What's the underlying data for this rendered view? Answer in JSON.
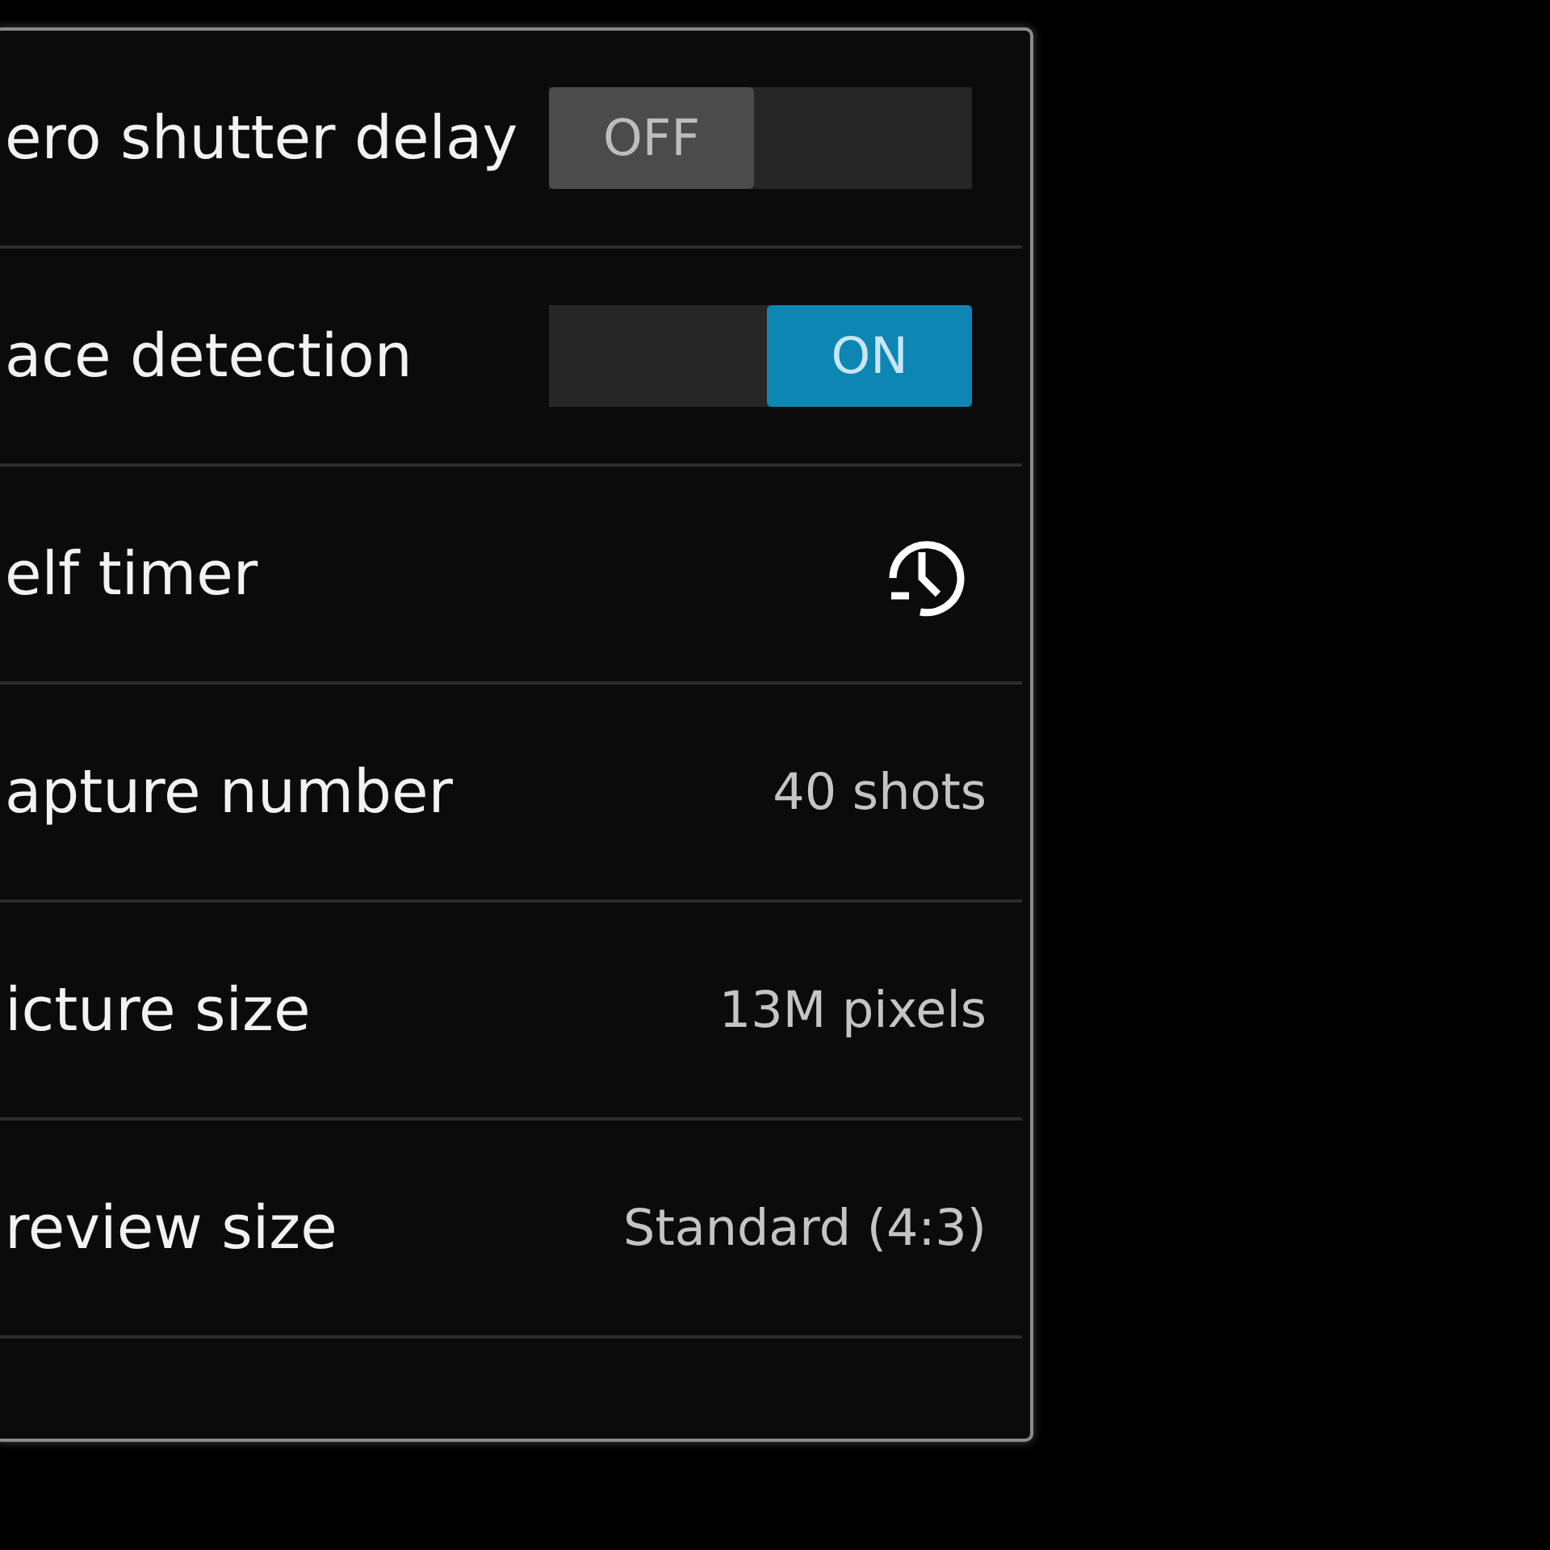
{
  "settings": [
    {
      "kind": "toggle",
      "label": "ero shutter delay",
      "on": false,
      "state_text": "OFF"
    },
    {
      "kind": "toggle",
      "label": "ace detection",
      "on": true,
      "state_text": "ON"
    },
    {
      "kind": "icon",
      "label": "elf timer"
    },
    {
      "kind": "value",
      "label": "apture number",
      "value": "40 shots"
    },
    {
      "kind": "value",
      "label": "icture size",
      "value": "13M pixels"
    },
    {
      "kind": "value",
      "label": "review size",
      "value": "Standard (4:3)"
    }
  ]
}
